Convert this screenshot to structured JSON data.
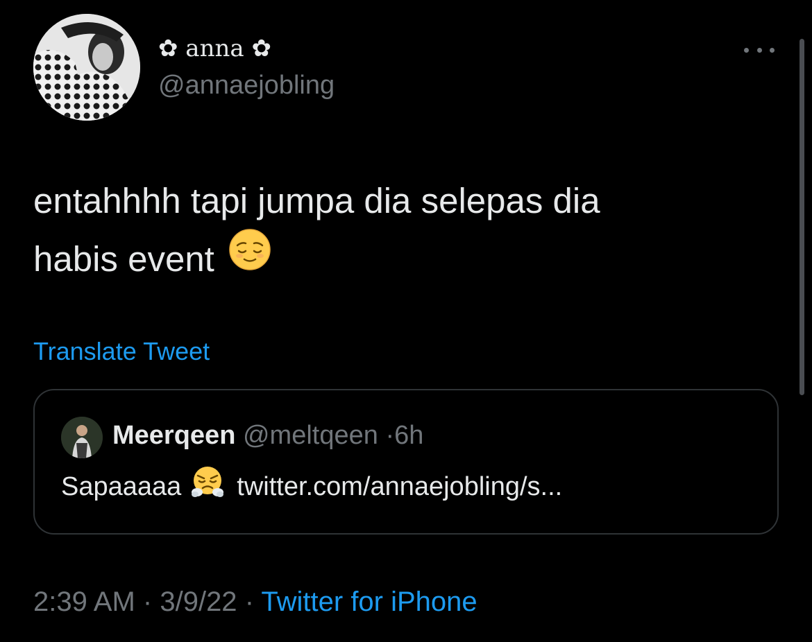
{
  "tweet": {
    "author": {
      "display_name": "✿ anna ✿",
      "handle": "@annaejobling"
    },
    "text_line1": "entahhhh tapi jumpa dia selepas dia",
    "text_line2": "habis event",
    "text_emoji": "relieved-face",
    "translate_label": "Translate Tweet",
    "quoted": {
      "name": "Meerqeen",
      "handle": "@meltqeen",
      "separator": "·",
      "time": "6h",
      "text": "Sapaaaaa",
      "emoji": "face-with-steam-from-nose",
      "link": "twitter.com/annaejobling/s..."
    },
    "time": "2:39 AM",
    "separator": "·",
    "date": "3/9/22",
    "source": "Twitter for iPhone"
  },
  "colors": {
    "background": "#000000",
    "text": "#e7e9ea",
    "secondary": "#71767b",
    "accent": "#1d9bf0",
    "border": "#2f3336"
  },
  "icons": {
    "more": "more-horizontal-icon"
  }
}
